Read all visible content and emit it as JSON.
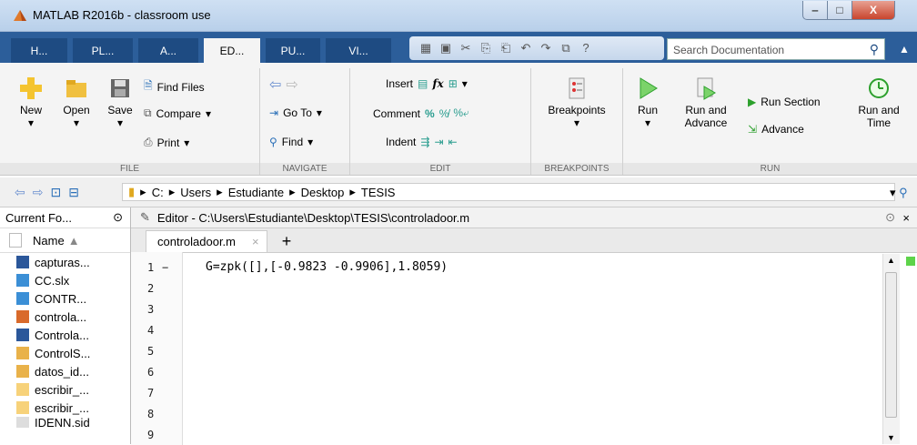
{
  "window": {
    "title": "MATLAB R2016b - classroom use"
  },
  "tabs": [
    "H...",
    "PL...",
    "A...",
    "ED...",
    "PU...",
    "VI..."
  ],
  "search": {
    "placeholder": "Search Documentation"
  },
  "ribbon": {
    "file": {
      "label": "FILE",
      "new": "New",
      "open": "Open",
      "save": "Save",
      "find_files": "Find Files",
      "compare": "Compare",
      "print": "Print"
    },
    "navigate": {
      "label": "NAVIGATE",
      "goto": "Go To",
      "find": "Find"
    },
    "edit": {
      "label": "EDIT",
      "insert": "Insert",
      "comment": "Comment",
      "indent": "Indent",
      "fx": "fx"
    },
    "breakpoints": {
      "label": "BREAKPOINTS",
      "breakpoints": "Breakpoints"
    },
    "run": {
      "label": "RUN",
      "run": "Run",
      "run_and_advance_1": "Run and",
      "run_and_advance_2": "Advance",
      "run_section": "Run Section",
      "advance": "Advance",
      "run_and_time_1": "Run and",
      "run_and_time_2": "Time"
    }
  },
  "path": [
    "C:",
    "Users",
    "Estudiante",
    "Desktop",
    "TESIS"
  ],
  "current_folder": {
    "title": "Current Fo...",
    "name_col": "Name",
    "files": [
      {
        "name": "capturas...",
        "icon": "word-doc-icon"
      },
      {
        "name": "CC.slx",
        "icon": "simulink-icon"
      },
      {
        "name": "CONTR...",
        "icon": "simulink-icon"
      },
      {
        "name": "controla...",
        "icon": "fig-icon"
      },
      {
        "name": "Controla...",
        "icon": "word-doc-icon"
      },
      {
        "name": "ControlS...",
        "icon": "mat-file-icon"
      },
      {
        "name": "datos_id...",
        "icon": "mat-file-icon"
      },
      {
        "name": "escribir_...",
        "icon": "function-icon"
      },
      {
        "name": "escribir_...",
        "icon": "function-icon"
      },
      {
        "name": "IDENN.sid",
        "icon": "file-icon"
      }
    ]
  },
  "editor": {
    "title": "Editor - C:\\Users\\Estudiante\\Desktop\\TESIS\\controladoor.m",
    "tab": "controladoor.m",
    "line_numbers": [
      "1",
      "2",
      "3",
      "4",
      "5",
      "6",
      "7",
      "8",
      "9"
    ],
    "line1_marker": "−",
    "code_line_1": "G=zpk([],[-0.9823 -0.9906],1.8059)"
  },
  "colors": {
    "tab_bar": "#2c5e9a",
    "ribbon": "#f4f4f4",
    "run_green": "#2ca02c"
  }
}
